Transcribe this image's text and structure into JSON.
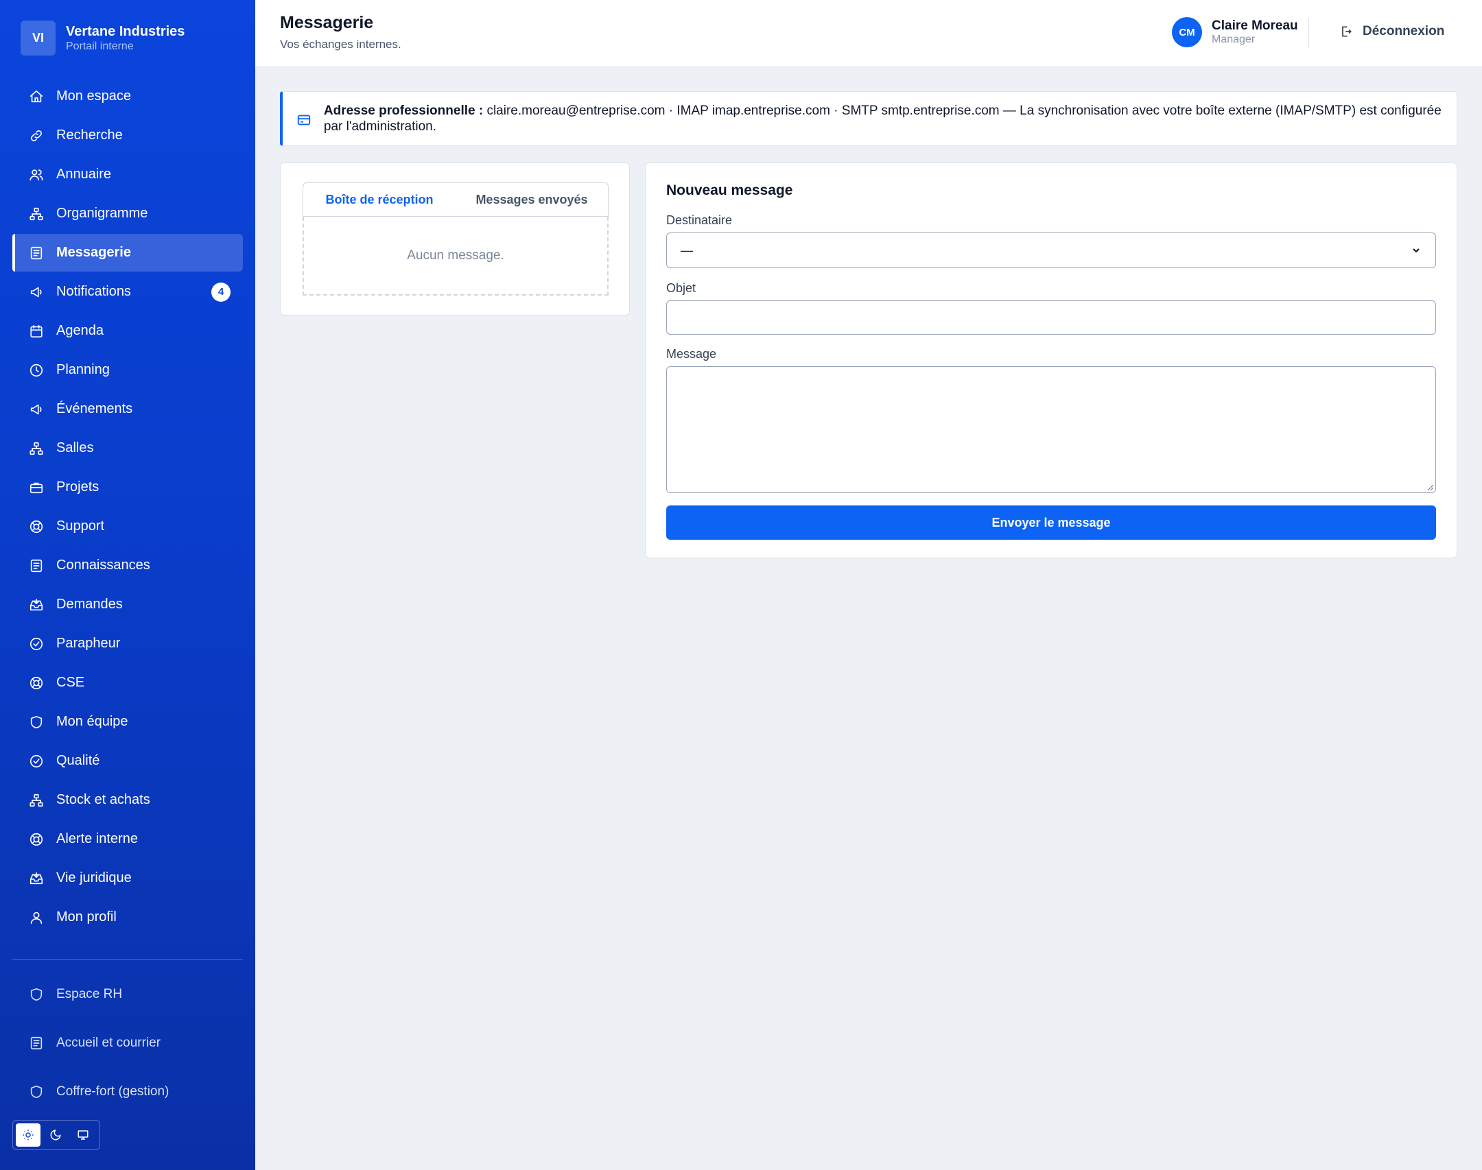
{
  "brand": {
    "initials": "VI",
    "name": "Vertane Industries",
    "subtitle": "Portail interne"
  },
  "sidebar": {
    "items": [
      {
        "label": "Mon espace",
        "icon": "home-icon"
      },
      {
        "label": "Recherche",
        "icon": "link-icon"
      },
      {
        "label": "Annuaire",
        "icon": "users-icon"
      },
      {
        "label": "Organigramme",
        "icon": "org-chart-icon"
      },
      {
        "label": "Messagerie",
        "icon": "document-icon",
        "active": true
      },
      {
        "label": "Notifications",
        "icon": "megaphone-icon",
        "badge": "4"
      },
      {
        "label": "Agenda",
        "icon": "calendar-icon"
      },
      {
        "label": "Planning",
        "icon": "clock-icon"
      },
      {
        "label": "Événements",
        "icon": "megaphone-icon"
      },
      {
        "label": "Salles",
        "icon": "org-chart-icon"
      },
      {
        "label": "Projets",
        "icon": "briefcase-icon"
      },
      {
        "label": "Support",
        "icon": "lifebuoy-icon"
      },
      {
        "label": "Connaissances",
        "icon": "document-icon"
      },
      {
        "label": "Demandes",
        "icon": "inbox-icon"
      },
      {
        "label": "Parapheur",
        "icon": "check-circle-icon"
      },
      {
        "label": "CSE",
        "icon": "lifebuoy-icon"
      },
      {
        "label": "Mon équipe",
        "icon": "shield-icon"
      },
      {
        "label": "Qualité",
        "icon": "check-circle-icon"
      },
      {
        "label": "Stock et achats",
        "icon": "org-chart-icon"
      },
      {
        "label": "Alerte interne",
        "icon": "lifebuoy-icon"
      },
      {
        "label": "Vie juridique",
        "icon": "inbox-icon"
      },
      {
        "label": "Mon profil",
        "icon": "user-icon"
      }
    ],
    "admin_items": [
      {
        "label": "Espace RH",
        "icon": "shield-icon"
      },
      {
        "label": "Accueil et courrier",
        "icon": "document-icon"
      },
      {
        "label": "Coffre-fort (gestion)",
        "icon": "shield-icon"
      }
    ],
    "theme_options": [
      "sun-icon",
      "moon-icon",
      "monitor-icon"
    ]
  },
  "header": {
    "title": "Messagerie",
    "subtitle": "Vos échanges internes.",
    "user": {
      "initials": "CM",
      "name": "Claire Moreau",
      "role": "Manager"
    },
    "logout_label": "Déconnexion"
  },
  "banner": {
    "label": "Adresse professionnelle :",
    "text": " claire.moreau@entreprise.com · IMAP imap.entreprise.com · SMTP smtp.entreprise.com — La synchronisation avec votre boîte externe (IMAP/SMTP) est configurée par l'administration."
  },
  "mailbox": {
    "tabs": [
      "Boîte de réception",
      "Messages envoyés"
    ],
    "active_tab": 0,
    "empty_text": "Aucun message."
  },
  "compose": {
    "title": "Nouveau message",
    "recipient_label": "Destinataire",
    "recipient_value": "—",
    "subject_label": "Objet",
    "subject_value": "",
    "message_label": "Message",
    "message_value": "",
    "send_label": "Envoyer le message"
  },
  "colors": {
    "sidebar": "#0b45dc",
    "accent": "#0d63f3",
    "background": "#edf0f5"
  }
}
